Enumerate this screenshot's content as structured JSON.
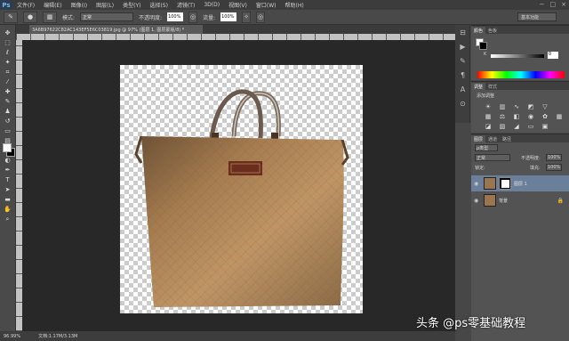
{
  "app": {
    "logo": "Ps"
  },
  "menu": [
    "文件(F)",
    "编辑(E)",
    "图像(I)",
    "图层(L)",
    "类型(Y)",
    "选择(S)",
    "滤镜(T)",
    "3D(D)",
    "视图(V)",
    "窗口(W)",
    "帮助(H)"
  ],
  "options": {
    "mode_label": "模式:",
    "mode_value": "正常",
    "opacity_label": "不透明度:",
    "opacity_value": "100%",
    "flow_label": "流量:",
    "flow_value": "100%",
    "workspace": "基本功能"
  },
  "document": {
    "tab_title": "3A6B97622C82AC143EF5E6C03819.jpg @ 97% (图层 1, 图层蒙版/8) *",
    "zoom": "96.99%",
    "doc_size": "文档:1.17M/3.13M"
  },
  "panels": {
    "color_tabs": [
      "颜色",
      "色板"
    ],
    "color_channel": "K",
    "color_value": "0",
    "adjust_tabs": [
      "调整",
      "样式"
    ],
    "adjust_title": "添加调整",
    "adjust_icons": [
      "brightness-icon",
      "levels-icon",
      "curves-icon",
      "exposure-icon",
      "vibrance-icon",
      "hsl-icon",
      "color-balance-icon",
      "bw-icon",
      "photo-filter-icon",
      "channel-mixer-icon",
      "lookup-icon",
      "invert-icon",
      "posterize-icon",
      "threshold-icon",
      "gradient-map-icon",
      "selective-color-icon"
    ],
    "layers_tabs": [
      "图层",
      "通道",
      "路径"
    ],
    "layer_kind": "ρ类型",
    "blend_mode": "正常",
    "opacity_label": "不透明度:",
    "opacity_value": "100%",
    "lock_label": "锁定:",
    "fill_label": "填充:",
    "fill_value": "100%",
    "layers": [
      {
        "name": "图层 1",
        "has_mask": true,
        "selected": true
      },
      {
        "name": "背景",
        "has_mask": false,
        "selected": false,
        "locked": true
      }
    ]
  },
  "watermark": "头条 @ps零基础教程",
  "colors": {
    "accent_selected_layer": "#6a7f9a",
    "bag_main": "#a67c52"
  }
}
